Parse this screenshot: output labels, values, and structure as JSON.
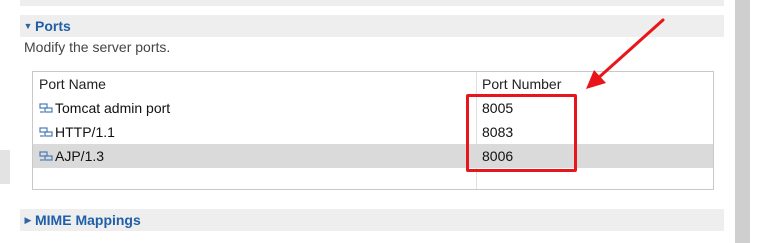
{
  "ports_section": {
    "title": "Ports",
    "description": "Modify the server ports.",
    "table": {
      "columns": [
        "Port Name",
        "Port Number"
      ],
      "rows": [
        {
          "name": "Tomcat admin port",
          "number": "8005"
        },
        {
          "name": "HTTP/1.1",
          "number": "8083"
        },
        {
          "name": "AJP/1.3",
          "number": "8006"
        }
      ]
    }
  },
  "mime_section": {
    "title": "MIME Mappings"
  },
  "colors": {
    "accent": "#1f5fa8",
    "annotation": "#e8161a",
    "selection": "#dadada"
  }
}
